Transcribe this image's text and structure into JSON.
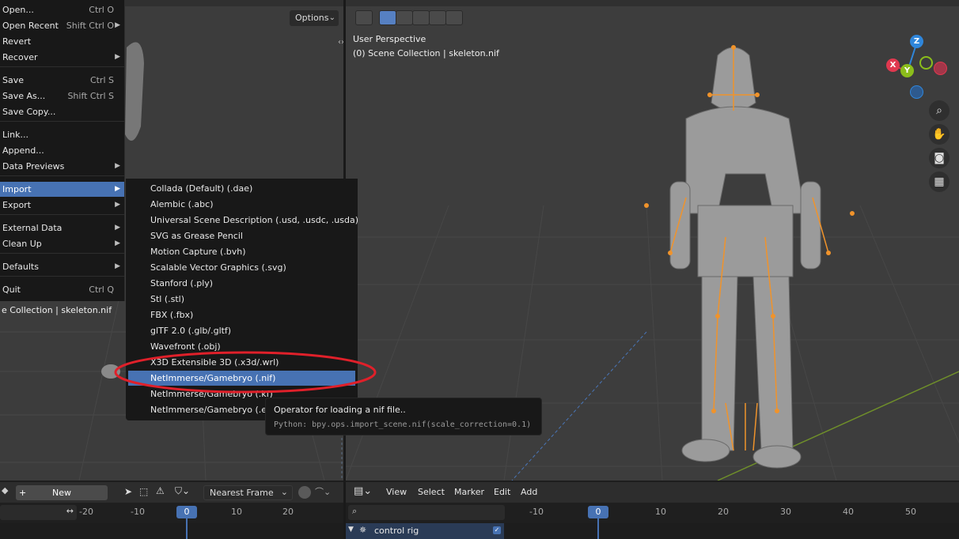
{
  "left_viewport": {
    "options_label": "Options",
    "collection_text": "e Collection | skeleton.nif"
  },
  "right_viewport": {
    "perspective_label": "User Perspective",
    "collection_text": "(0) Scene Collection | skeleton.nif"
  },
  "gizmo": {
    "z": "Z",
    "x": "X",
    "y": "Y",
    "colors": {
      "x": "#e0384f",
      "y": "#8bbd1b",
      "z": "#2f86db",
      "neg_z": "#2e5a8e",
      "neg_x": "#a33649"
    }
  },
  "file_menu": {
    "items": [
      {
        "label": "Open...",
        "shortcut": "Ctrl O"
      },
      {
        "label": "Open Recent",
        "shortcut": "Shift Ctrl O"
      },
      {
        "label": "Revert",
        "shortcut": ""
      },
      {
        "label": "Recover",
        "shortcut": ""
      },
      {
        "label": "Save",
        "shortcut": "Ctrl S"
      },
      {
        "label": "Save As...",
        "shortcut": "Shift Ctrl S"
      },
      {
        "label": "Save Copy...",
        "shortcut": ""
      },
      {
        "label": "Link...",
        "shortcut": ""
      },
      {
        "label": "Append...",
        "shortcut": ""
      },
      {
        "label": "Data Previews",
        "shortcut": ""
      },
      {
        "label": "Import",
        "shortcut": ""
      },
      {
        "label": "Export",
        "shortcut": ""
      },
      {
        "label": "External Data",
        "shortcut": ""
      },
      {
        "label": "Clean Up",
        "shortcut": ""
      },
      {
        "label": "Defaults",
        "shortcut": ""
      },
      {
        "label": "Quit",
        "shortcut": "Ctrl Q"
      }
    ]
  },
  "import_submenu": {
    "items": [
      "Collada (Default) (.dae)",
      "Alembic (.abc)",
      "Universal Scene Description (.usd, .usdc, .usda)",
      "SVG as Grease Pencil",
      "Motion Capture (.bvh)",
      "Scalable Vector Graphics (.svg)",
      "Stanford (.ply)",
      "Stl (.stl)",
      "FBX (.fbx)",
      "glTF 2.0 (.glb/.gltf)",
      "Wavefront (.obj)",
      "X3D Extensible 3D (.x3d/.wrl)",
      "NetImmerse/Gamebryo (.nif)",
      "NetImmerse/Gamebryo (.kf)",
      "NetImmerse/Gamebryo (.egm)"
    ],
    "highlighted": "NetImmerse/Gamebryo (.nif)",
    "highlight_color": "#4772b3",
    "annotation_color": "#e0202a"
  },
  "tooltip": {
    "title": "Operator for loading a nif file..",
    "python": "Python: bpy.ops.import_scene.nif(scale_correction=0.1)"
  },
  "left_timeline": {
    "new_label": "New",
    "snap_label": "Nearest Frame",
    "ticks": [
      "-20",
      "-10",
      "0",
      "10",
      "20"
    ],
    "current_frame": "0"
  },
  "right_timeline": {
    "menus": [
      "View",
      "Select",
      "Marker",
      "Edit",
      "Add"
    ],
    "ticks": [
      "-10",
      "0",
      "10",
      "20",
      "30",
      "40",
      "50"
    ],
    "current_frame": "0",
    "channel_label": "control rig"
  }
}
